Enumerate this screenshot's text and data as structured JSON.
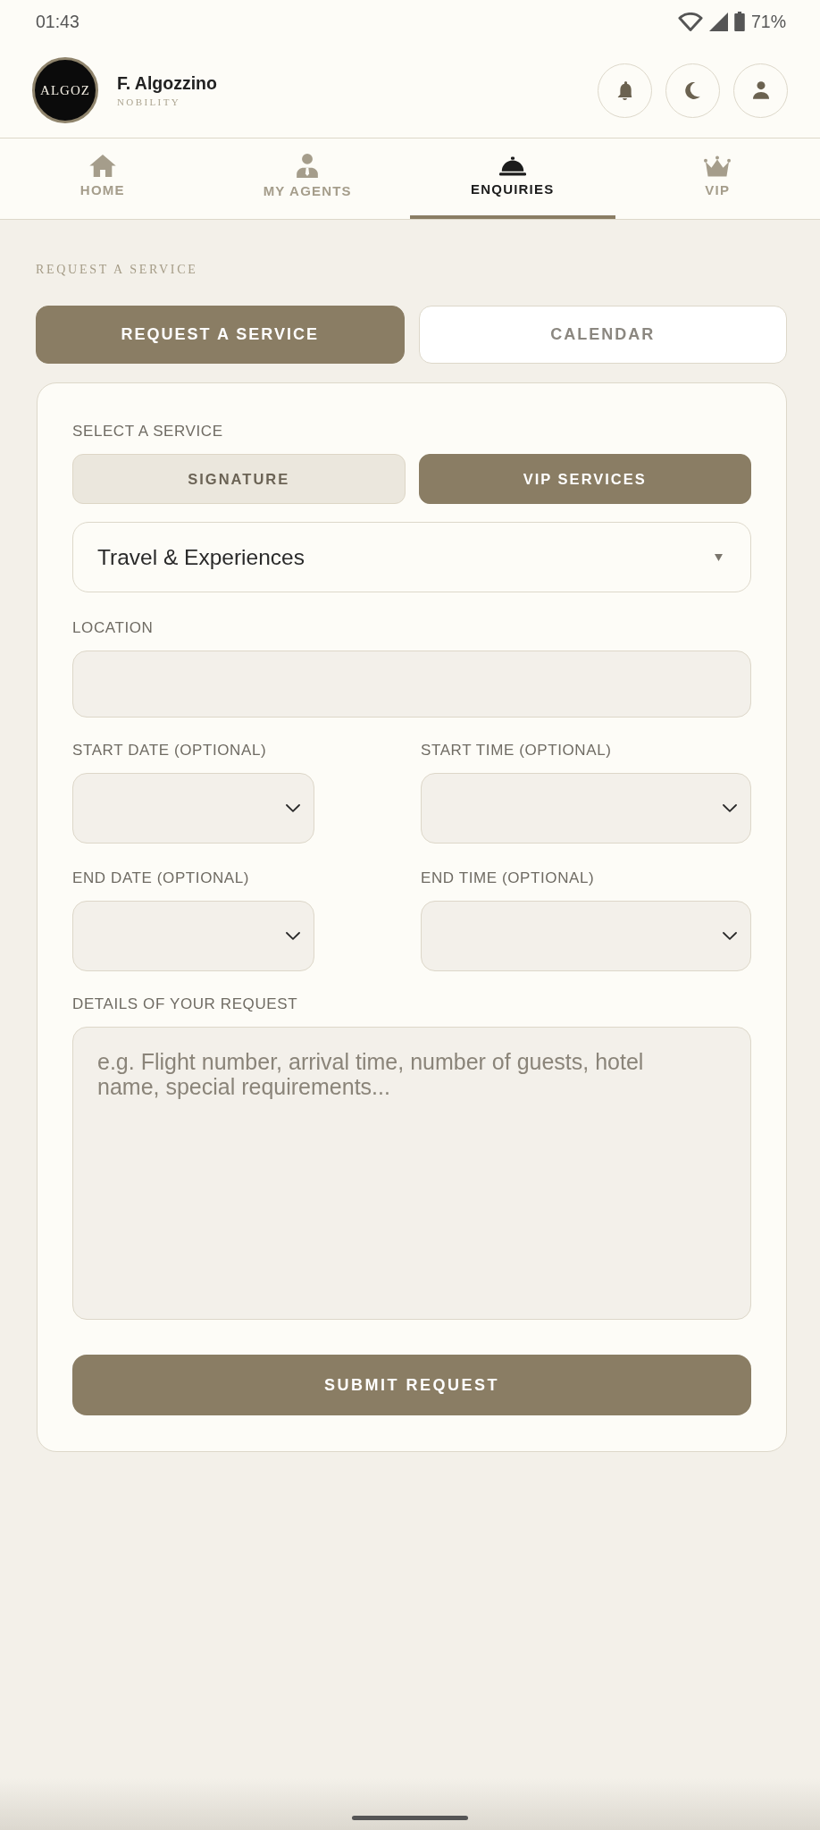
{
  "status_bar": {
    "time": "01:43",
    "battery": "71%"
  },
  "header": {
    "avatar": "ALGOZ",
    "name": "F. Algozzino",
    "tier": "NOBILITY"
  },
  "nav_tabs": [
    {
      "label": "HOME",
      "selected": false
    },
    {
      "label": "MY AGENTS",
      "selected": false
    },
    {
      "label": "ENQUIRIES",
      "selected": true
    },
    {
      "label": "VIP",
      "selected": false
    }
  ],
  "section_title": "REQUEST A SERVICE",
  "mode_buttons": [
    {
      "label": "REQUEST A SERVICE",
      "selected": true
    },
    {
      "label": "CALENDAR",
      "selected": false
    }
  ],
  "form": {
    "service_label": "SELECT A SERVICE",
    "service_options": [
      {
        "label": "SIGNATURE",
        "selected": false
      },
      {
        "label": "VIP SERVICES",
        "selected": true
      }
    ],
    "category_select": {
      "value": "Travel & Experiences"
    },
    "location": {
      "label": "LOCATION"
    },
    "schedule": [
      {
        "kind": "date",
        "label": "START DATE (OPTIONAL)"
      },
      {
        "kind": "time",
        "label": "START TIME (OPTIONAL)"
      },
      {
        "kind": "date",
        "label": "END DATE (OPTIONAL)"
      },
      {
        "kind": "time",
        "label": "END TIME (OPTIONAL)"
      }
    ],
    "details": {
      "label": "DETAILS OF YOUR REQUEST",
      "placeholder": "e.g. Flight number, arrival time, number of guests, hotel name, special requirements..."
    },
    "submit": "SUBMIT REQUEST"
  }
}
